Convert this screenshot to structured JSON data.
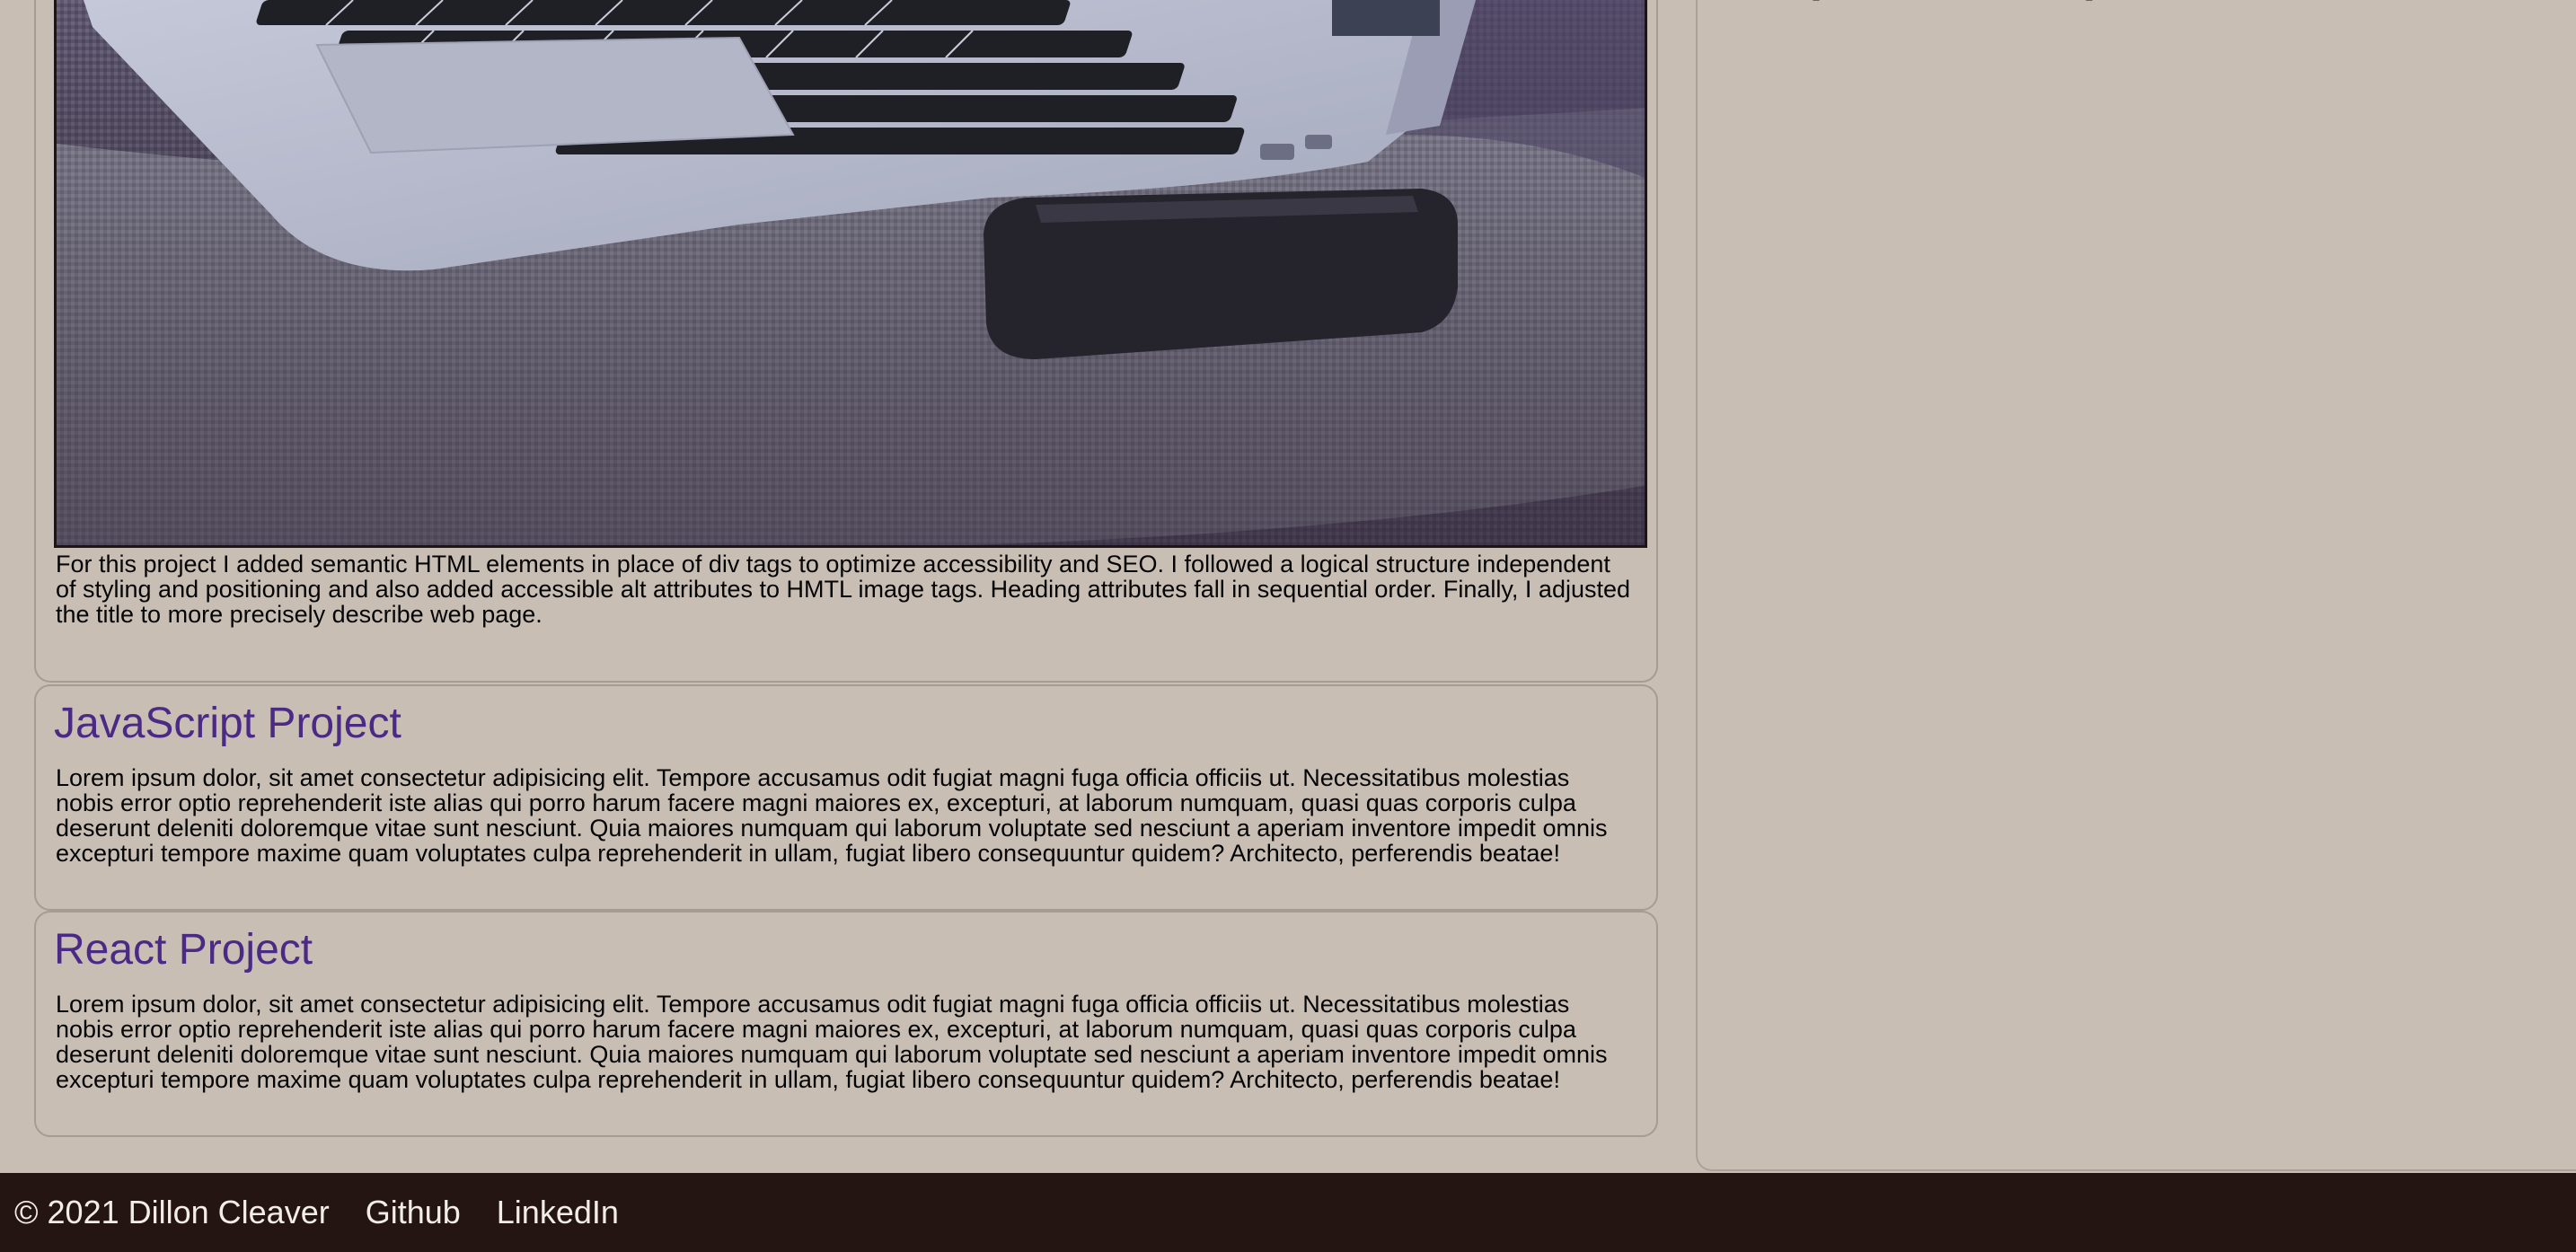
{
  "projects": [
    {
      "image_alt": "laptop and phone on couch",
      "description": "For this project I added semantic HTML elements in place of div tags to optimize accessibility and SEO. I followed a logical structure independent of styling and positioning and also added accessible alt attributes to HMTL image tags. Heading attributes fall in sequential order. Finally, I adjusted the title to more precisely describe web page."
    },
    {
      "title": "JavaScript Project",
      "description": "Lorem ipsum dolor, sit amet consectetur adipisicing elit. Tempore accusamus odit fugiat magni fuga officia officiis ut. Necessitatibus molestias nobis error optio reprehenderit iste alias qui porro harum facere magni maiores ex, excepturi, at laborum numquam, quasi quas corporis culpa deserunt deleniti doloremque vitae sunt nesciunt. Quia maiores numquam qui laborum voluptate sed nesciunt a aperiam inventore impedit omnis excepturi tempore maxime quam voluptates culpa reprehenderit in ullam, fugiat libero consequuntur quidem? Architecto, perferendis beatae!"
    },
    {
      "title": "React Project",
      "description": "Lorem ipsum dolor, sit amet consectetur adipisicing elit. Tempore accusamus odit fugiat magni fuga officia officiis ut. Necessitatibus molestias nobis error optio reprehenderit iste alias qui porro harum facere magni maiores ex, excepturi, at laborum numquam, quasi quas corporis culpa deserunt deleniti doloremque vitae sunt nesciunt. Quia maiores numquam qui laborum voluptate sed nesciunt a aperiam inventore impedit omnis excepturi tempore maxime quam voluptates culpa reprehenderit in ullam, fugiat libero consequuntur quidem? Architecto, perferendis beatae!"
    }
  ],
  "footer": {
    "copyright": "© 2021 Dillon Cleaver",
    "links": [
      "Github",
      "LinkedIn"
    ]
  },
  "colors": {
    "page_background": "#c9beb4",
    "heading": "#4b2a86",
    "footer_background": "#241513",
    "footer_text": "#f2ede8"
  }
}
